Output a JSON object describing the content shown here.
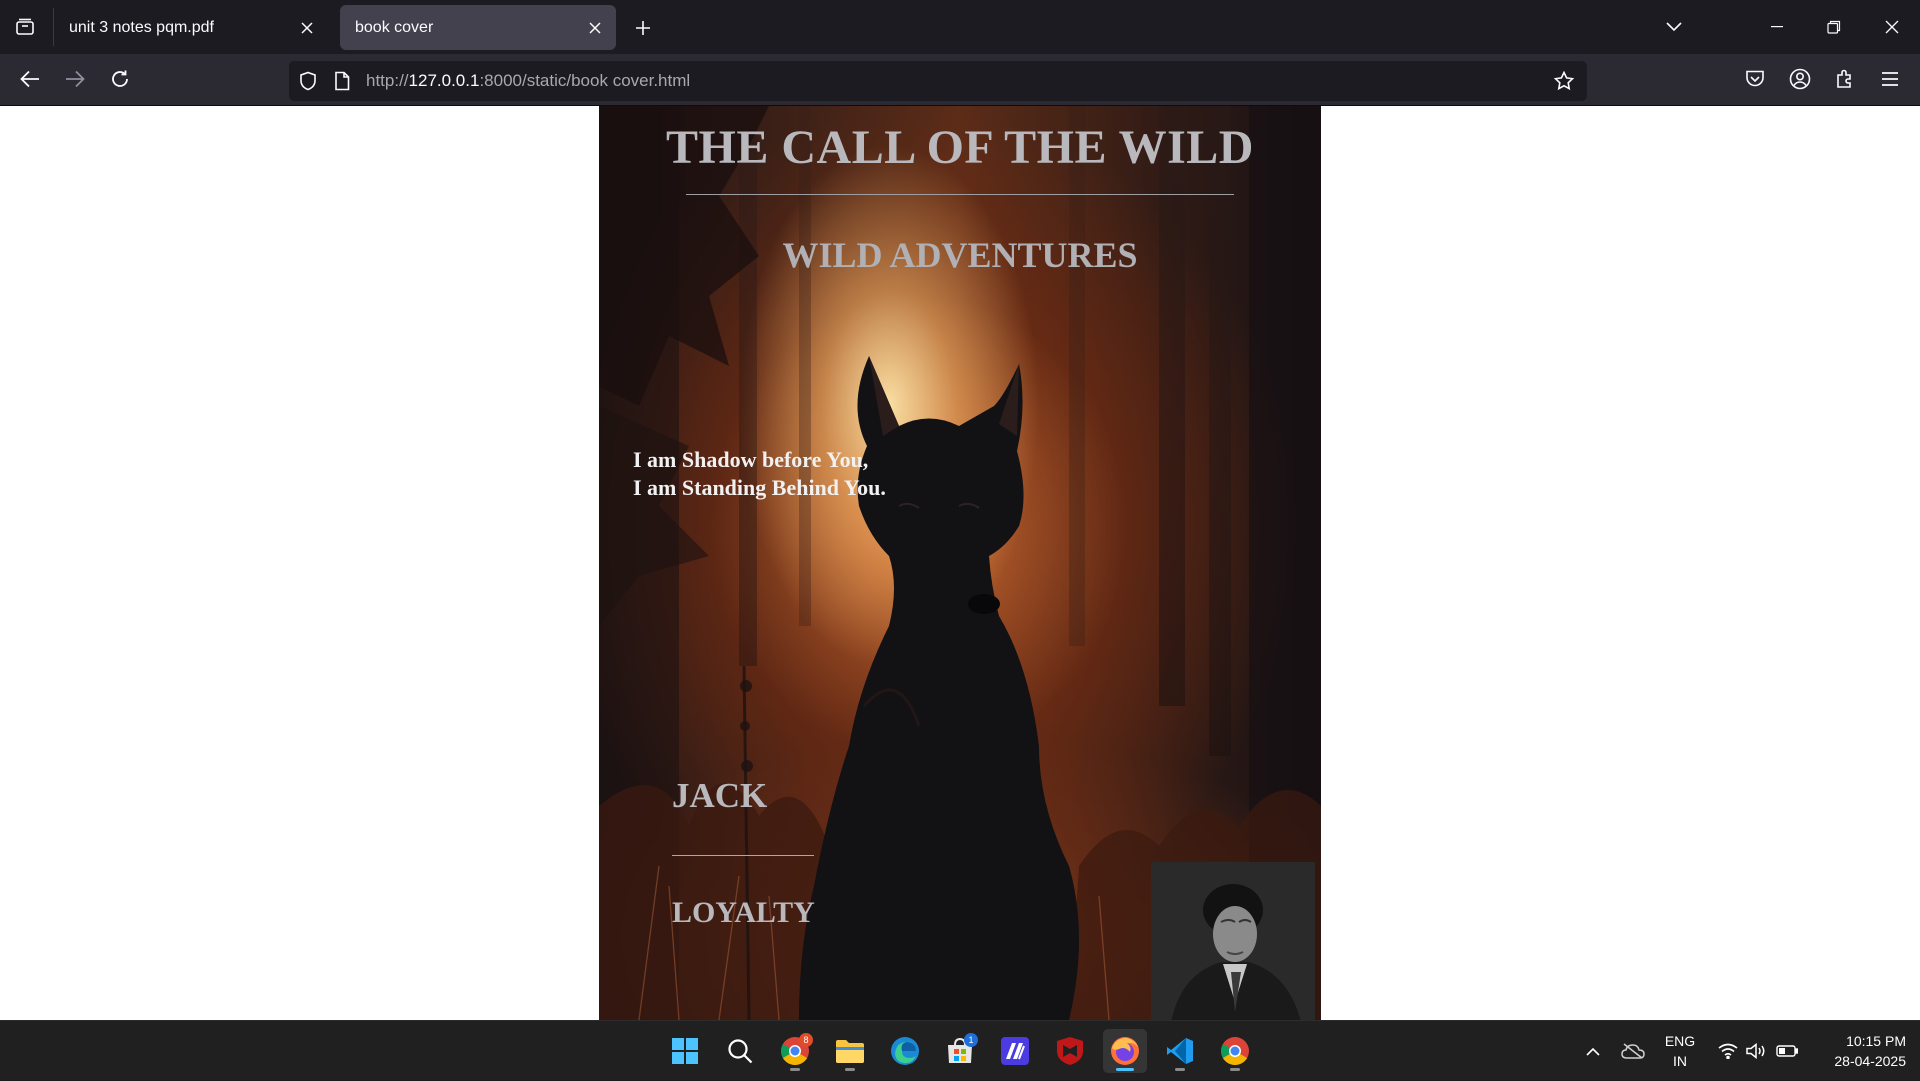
{
  "browser": {
    "tabs": [
      {
        "label": "unit 3 notes pqm.pdf",
        "active": false
      },
      {
        "label": "book cover",
        "active": true
      }
    ],
    "url": {
      "prefix": "http://",
      "host": "127.0.0.1",
      "rest": ":8000/static/book cover.html"
    }
  },
  "cover": {
    "title": "THE CALL OF THE WILD",
    "subtitle": "WILD ADVENTURES",
    "quote_line1": "I am Shadow before You,",
    "quote_line2": "I am Standing Behind You.",
    "author": "JACK",
    "theme": "LOYALTY"
  },
  "taskbar": {
    "apps": [
      {
        "icon": "windows-start-icon"
      },
      {
        "icon": "search-icon"
      },
      {
        "icon": "chrome-icon",
        "badge": "8"
      },
      {
        "icon": "file-explorer-icon"
      },
      {
        "icon": "edge-icon"
      },
      {
        "icon": "microsoft-store-icon",
        "badge": "1"
      },
      {
        "icon": "editor-app-icon"
      },
      {
        "icon": "mcafee-icon"
      },
      {
        "icon": "firefox-icon",
        "active": true
      },
      {
        "icon": "vscode-icon"
      },
      {
        "icon": "chrome-profile-icon"
      }
    ],
    "language_line1": "ENG",
    "language_line2": "IN",
    "time": "10:15 PM",
    "date": "28-04-2025"
  },
  "colors": {
    "tab_bg": "#1c1b22",
    "toolbar_bg": "#2b2a33",
    "active_tab": "#42414d",
    "taskbar_bg": "#202020",
    "accent": "#4cc2ff"
  }
}
